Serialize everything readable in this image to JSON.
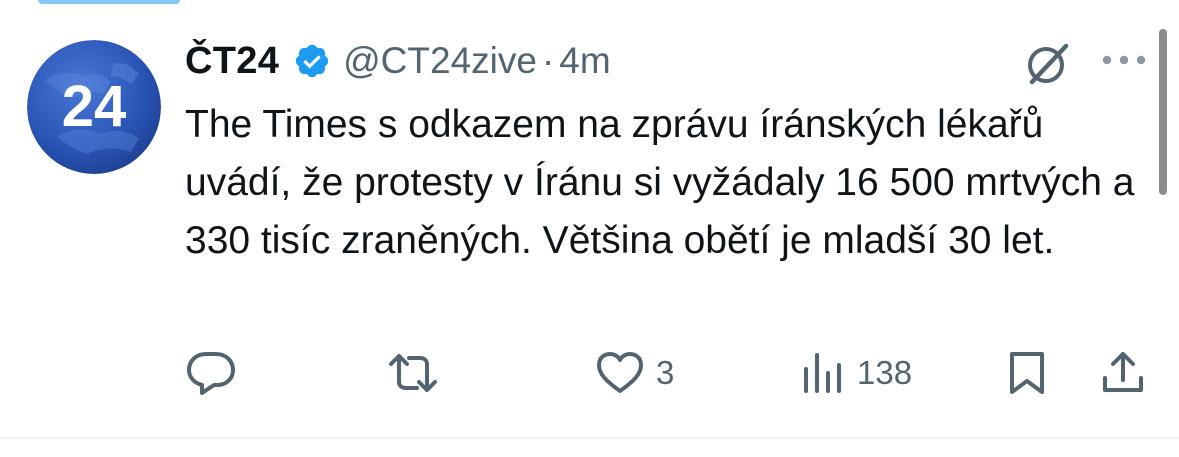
{
  "tweet": {
    "display_name": "ČT24",
    "handle": "@CT24zive",
    "separator": "·",
    "time": "4m",
    "avatar_text": "24",
    "text": "The Times s odkazem na zprávu íránských lékařů uvádí, že protesty v Íránu si vyžádaly 16 500 mrtvých a 330 tisíc zraněných. Většina obětí je mladší 30 let.",
    "verified_color": "#1d9bf0",
    "brand_color": "#2a4fa8"
  },
  "actions": {
    "reply_icon": "reply-icon",
    "retweet_icon": "retweet-icon",
    "like_icon": "heart-icon",
    "like_count": "3",
    "views_icon": "views-chart-icon",
    "views_count": "138",
    "bookmark_icon": "bookmark-icon",
    "share_icon": "share-icon"
  },
  "header_icons": {
    "grok": "grok-icon",
    "more": "more-options-icon"
  }
}
